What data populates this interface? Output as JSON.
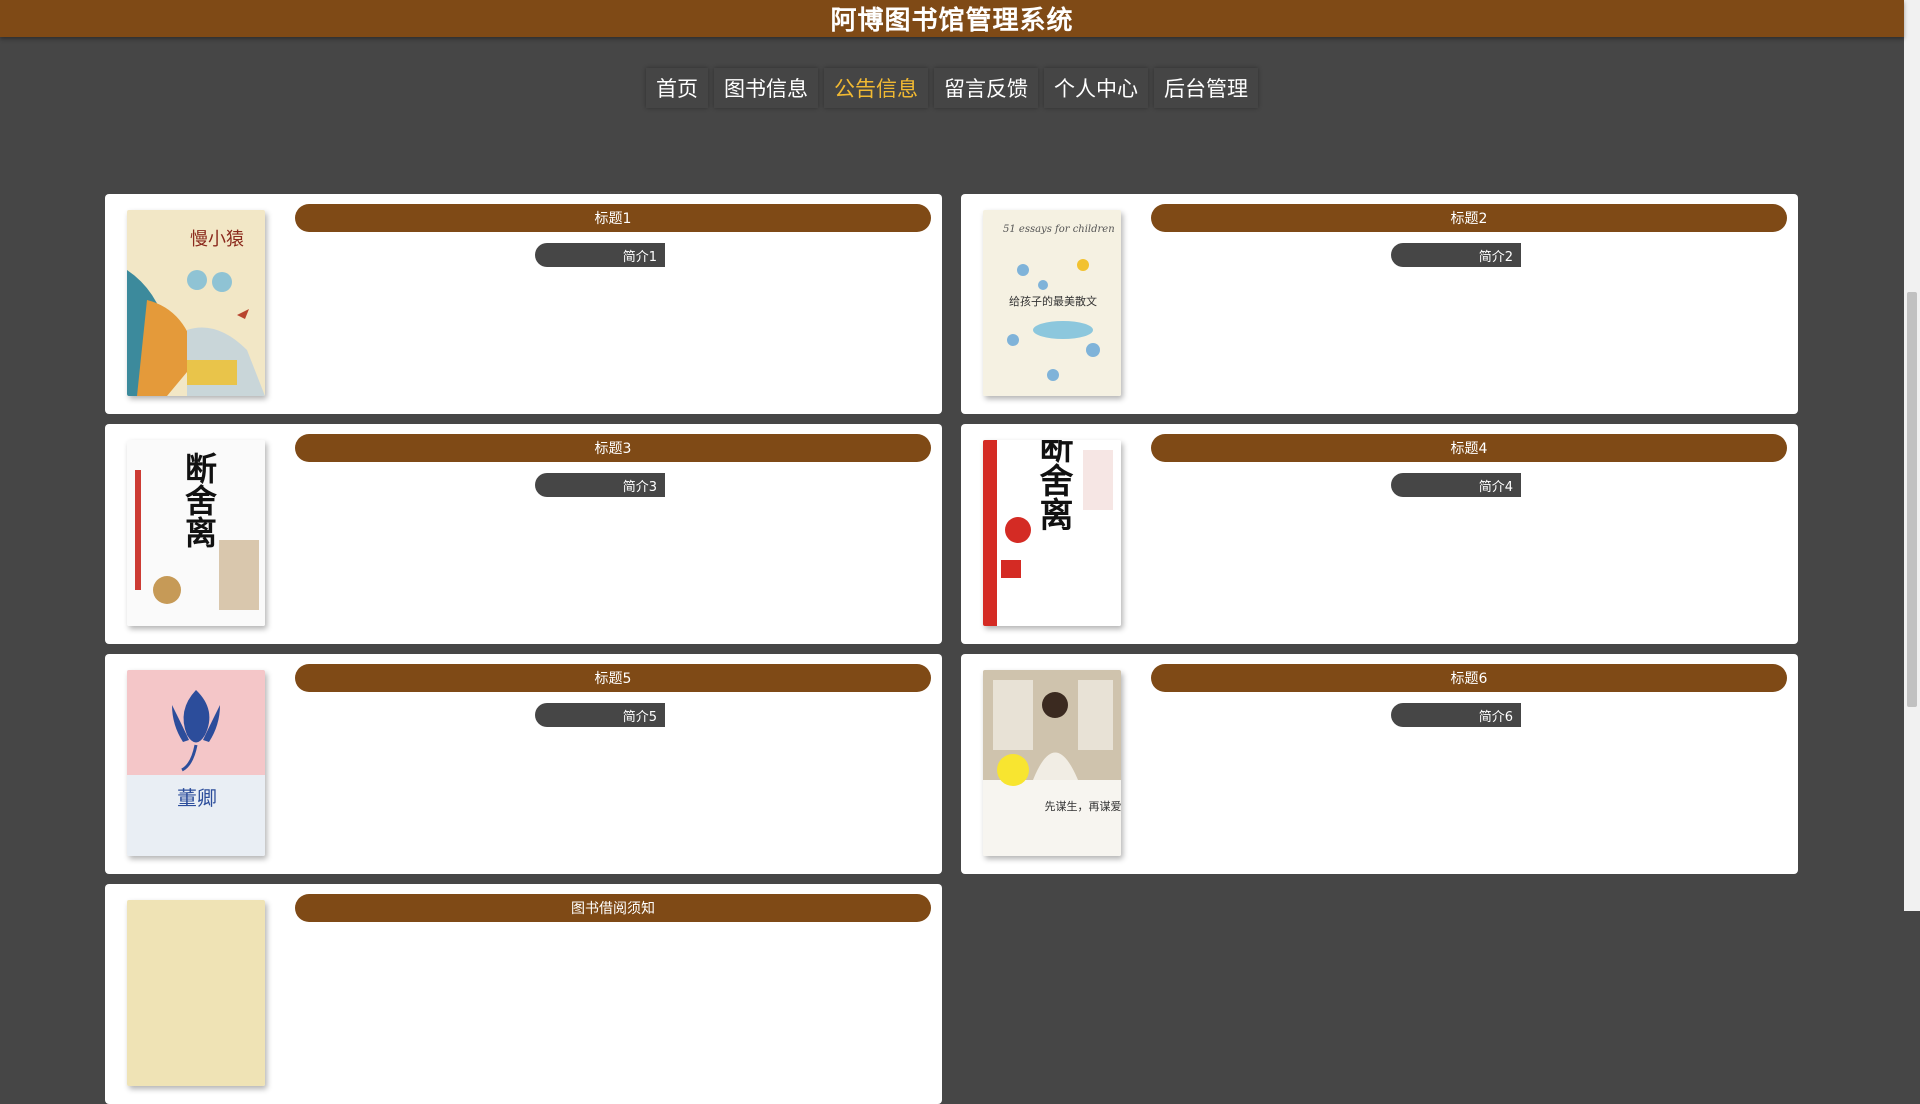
{
  "header": {
    "title": "阿博图书馆管理系统"
  },
  "nav": {
    "items": [
      {
        "label": "首页",
        "active": false
      },
      {
        "label": "图书信息",
        "active": false
      },
      {
        "label": "公告信息",
        "active": true
      },
      {
        "label": "留言反馈",
        "active": false
      },
      {
        "label": "个人中心",
        "active": false
      },
      {
        "label": "后台管理",
        "active": false
      }
    ]
  },
  "notices": [
    {
      "title": "标题1",
      "summary": "简介1",
      "cover_text": "慢小猿"
    },
    {
      "title": "标题2",
      "summary": "简介2",
      "cover_text": "给孩子的最美散文",
      "cover_subtext": "51 essays for children"
    },
    {
      "title": "标题3",
      "summary": "简介3",
      "cover_text": "断舍离"
    },
    {
      "title": "标题4",
      "summary": "简介4",
      "cover_text": "断舍离"
    },
    {
      "title": "标题5",
      "summary": "简介5",
      "cover_text": "董卿"
    },
    {
      "title": "标题6",
      "summary": "简介6",
      "cover_text": "先谋生，再谋爱"
    },
    {
      "title": "图书借阅须知",
      "summary": "",
      "cover_text": ""
    }
  ],
  "colors": {
    "brand": "#7f4a16",
    "background": "#464646",
    "nav_active": "#f1b932"
  }
}
